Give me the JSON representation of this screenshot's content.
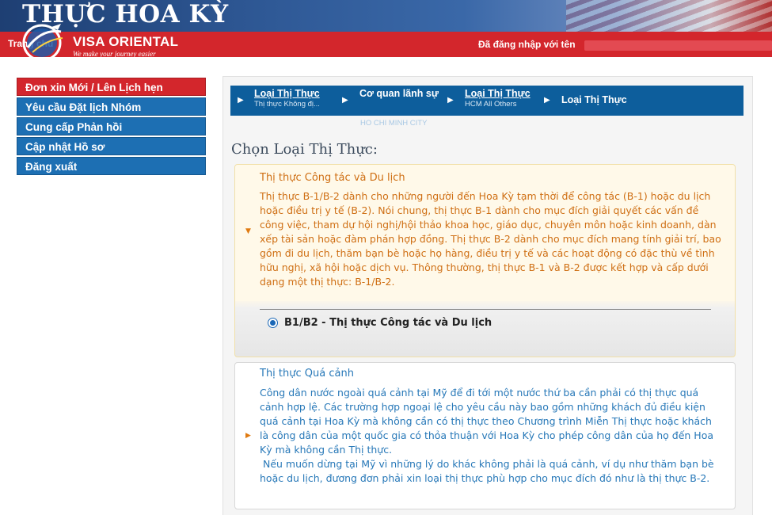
{
  "header": {
    "title": "THỰC HOA KỲ",
    "nav_home": "Trang chủ",
    "logo_name": "VISA ORIENTAL",
    "logo_tagline": "We make your journey easier",
    "login_text": "Đã đăng nhập với tên"
  },
  "sidebar": {
    "items": [
      {
        "label": "Đơn xin Mới / Lên Lịch hẹn",
        "active": true
      },
      {
        "label": "Yêu cầu Đặt lịch Nhóm"
      },
      {
        "label": "Cung cấp Phản hồi"
      },
      {
        "label": "Cập nhật Hồ sơ"
      },
      {
        "label": "Đăng xuất"
      }
    ]
  },
  "breadcrumb": {
    "items": [
      {
        "title": "Loại Thị Thực",
        "sub": "Thị thực Không đị..."
      },
      {
        "title": "Cơ quan lãnh sự",
        "sub": "HO CHI MINH CITY"
      },
      {
        "title": "Loại Thị Thực",
        "sub": "HCM All Others"
      },
      {
        "title": "Loại Thị Thực",
        "sub": ""
      }
    ]
  },
  "main": {
    "heading": "Chọn Loại Thị Thực:",
    "cards": [
      {
        "title": "Thị thực Công tác và Du lịch",
        "description": "Thị thực B-1/B-2 dành cho những người đến Hoa Kỳ tạm thời để công tác (B-1) hoặc du lịch hoặc điều trị y tế (B-2). Nói chung, thị thực B-1 dành cho mục đích giải quyết các vấn đề công việc, tham dự hội nghị/hội thảo khoa học, giáo dục, chuyên môn hoặc kinh doanh, dàn xếp tài sản hoặc đàm phán hợp đồng. Thị thực B-2 dành cho  mục đích mang tính giải trí, bao gồm đi du lịch, thăm bạn bè hoặc họ hàng, điều trị y tế và các hoạt động có đặc thù về tình hữu nghị, xã hội hoặc dịch vụ. Thông thường, thị thực B-1 và B-2 được kết hợp và cấp dưới dạng một thị thực: B-1/B-2.",
        "option_label": "B1/B2 - Thị thực Công tác và Du lịch",
        "selected": true
      },
      {
        "title": "Thị thực Quá cảnh",
        "description_1": "Công dân nước ngoài quá cảnh tại Mỹ để đi tới một nước thứ ba cần phải có thị thực quá cảnh hợp lệ. Các trường hợp ngoại lệ cho yêu cầu này bao gồm những khách đủ điều kiện quá cảnh tại Hoa Kỳ mà không cần có thị thực theo Chương trình Miễn Thị thực hoặc khách là công dân của một quốc gia có thỏa thuận với Hoa Kỳ cho phép công dân của họ đến Hoa Kỳ mà không cần Thị thực.",
        "description_2": " Nếu muốn dừng tại Mỹ vì những lý do khác không phải là quá cảnh, ví dụ như thăm bạn bè hoặc du lịch, đương đơn phải xin loại thị thực phù hợp cho mục đích đó như là thị thực B-2."
      }
    ]
  },
  "colors": {
    "red_bar": "#d3262c",
    "sidebar_blue": "#1d6fb3",
    "breadcrumb_blue": "#0d5e9c",
    "orange_text": "#cf6f14",
    "blue_text": "#2778b8"
  },
  "icons": {
    "breadcrumb_separator": "chevron-right-icon",
    "card_expanded": "triangle-down-icon",
    "card_collapsed": "triangle-right-icon",
    "logo": "globe-plane-logo"
  }
}
